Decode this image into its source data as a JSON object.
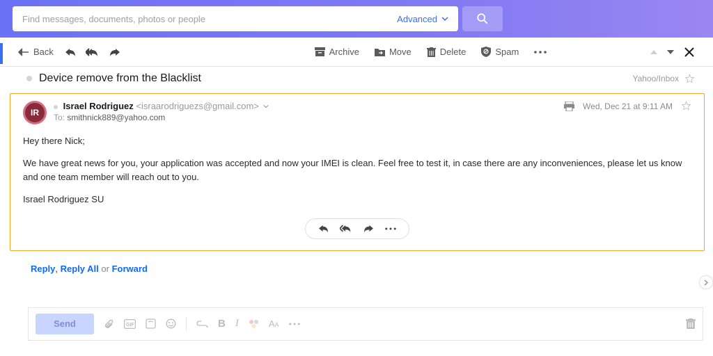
{
  "search": {
    "placeholder": "Find messages, documents, photos or people",
    "advanced_label": "Advanced"
  },
  "toolbar": {
    "back": "Back",
    "archive": "Archive",
    "move": "Move",
    "delete": "Delete",
    "spam": "Spam"
  },
  "message": {
    "subject": "Device remove from the Blacklist",
    "path": "Yahoo/Inbox",
    "sender_name": "Israel Rodriguez",
    "sender_email": "<israarodriguezs@gmail.com>",
    "to_label": "To:",
    "to_value": "smithnick889@yahoo.com",
    "date": "Wed, Dec 21 at 9:11 AM",
    "body_greeting": "Hey there Nick;",
    "body_main": "We have great news for you, your application was accepted and now your IMEI is clean. Feel free to test it, in case there are any inconveniences, please let us know and one team member will reach out to you.",
    "body_sig": "Israel Rodriguez SU"
  },
  "reply_links": {
    "reply": "Reply",
    "reply_all": "Reply All",
    "or": "or",
    "forward": "Forward",
    "sep": ", "
  },
  "compose": {
    "send": "Send"
  }
}
